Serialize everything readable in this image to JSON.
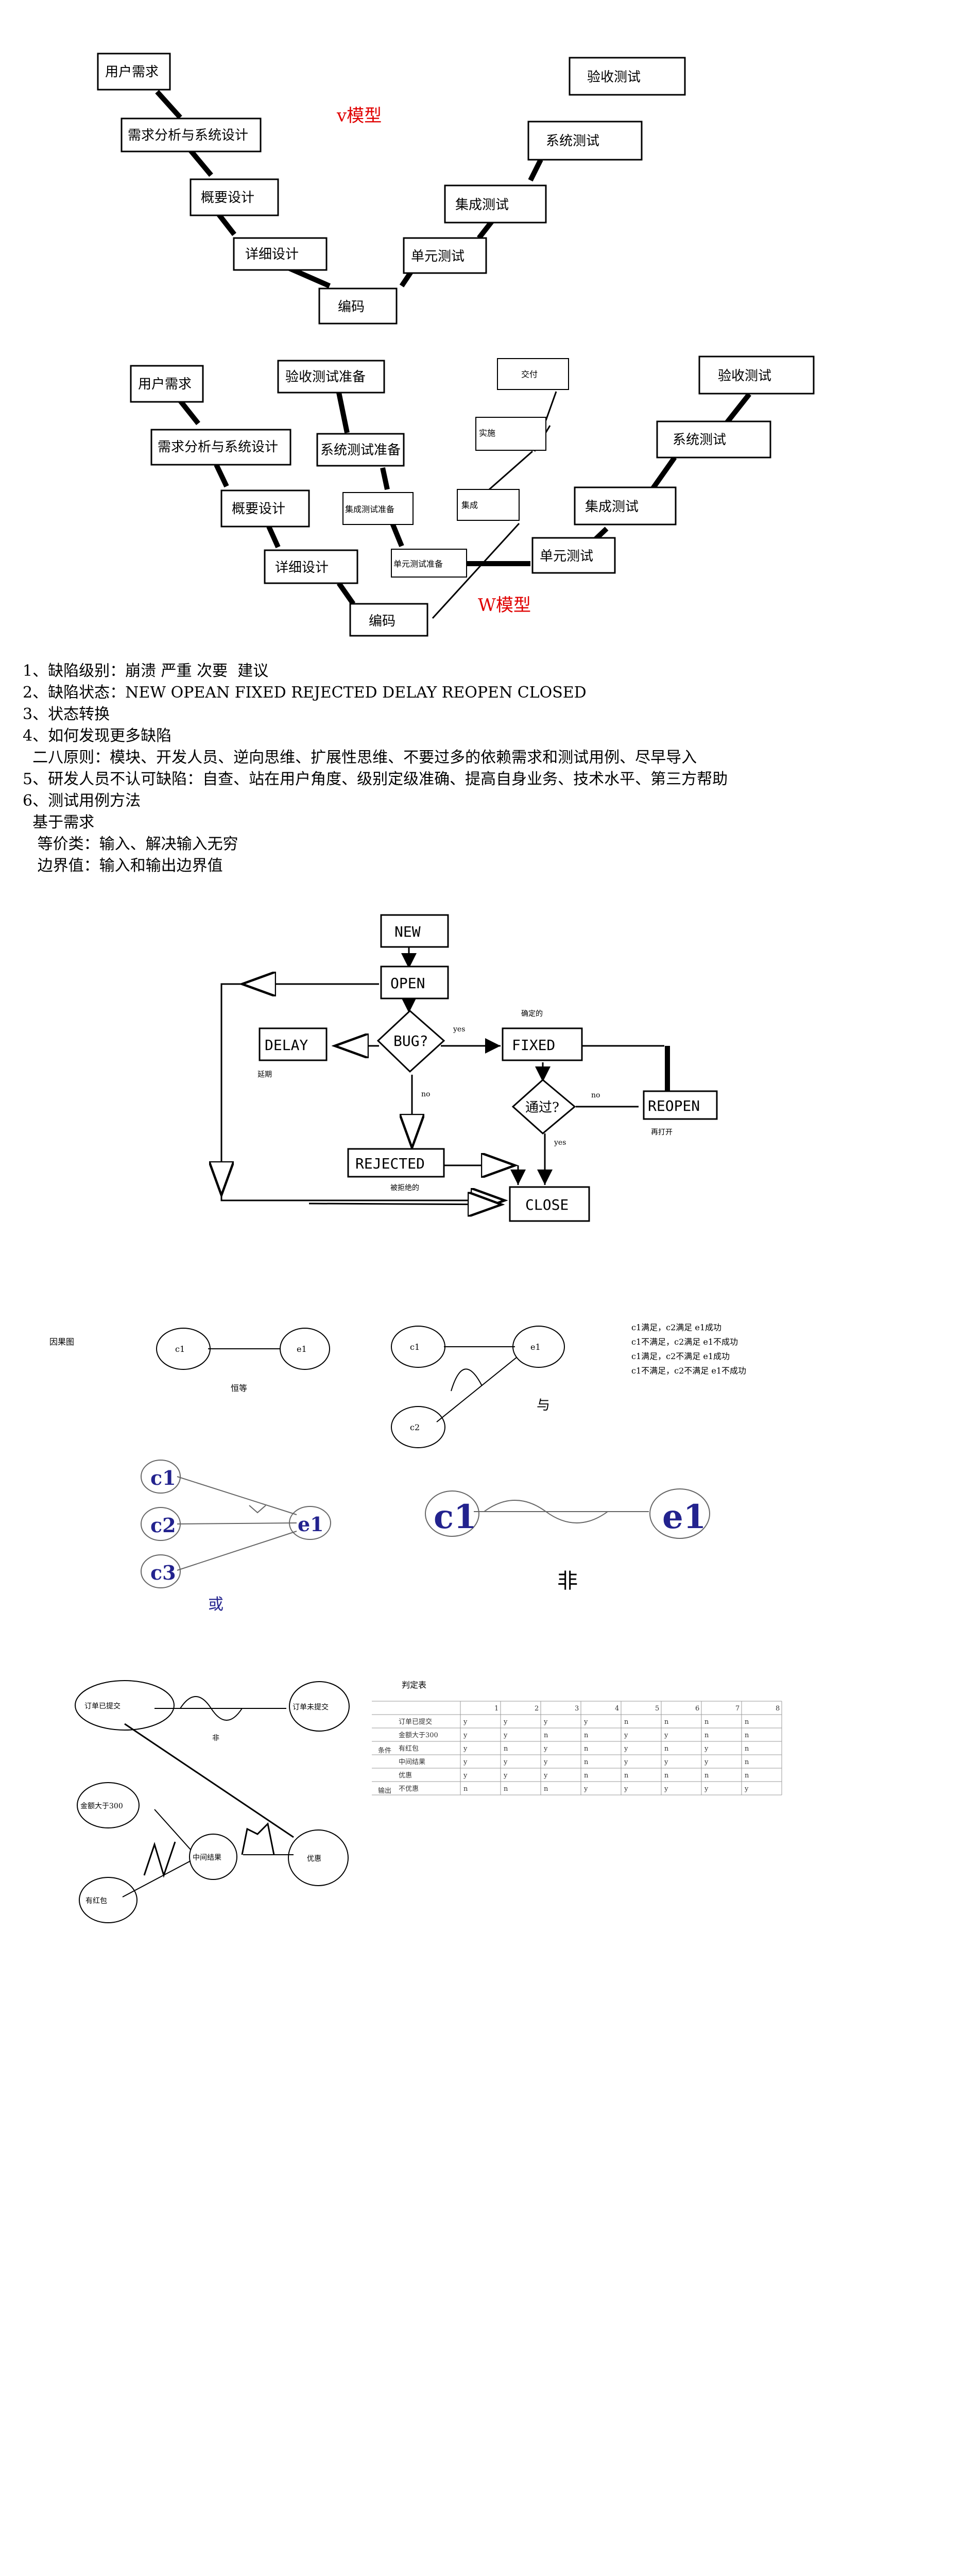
{
  "v_model": {
    "title": "v模型",
    "left": [
      "用户需求",
      "需求分析与系统设计",
      "概要设计",
      "详细设计"
    ],
    "bottom": "编码",
    "right": [
      "单元测试",
      "集成测试",
      "系统测试",
      "验收测试"
    ]
  },
  "w_model": {
    "title": "W模型",
    "left": [
      "用户需求",
      "需求分析与系统设计",
      "概要设计",
      "详细设计"
    ],
    "bottom": "编码",
    "prep": [
      "验收测试准备",
      "系统测试准备",
      "集成测试准备",
      "单元测试准备"
    ],
    "right": [
      "单元测试",
      "集成测试",
      "系统测试",
      "验收测试"
    ],
    "mid": [
      "交付",
      "实施",
      "集成"
    ]
  },
  "notes": [
    "1、缺陷级别：崩溃 严重 次要  建议",
    "2、缺陷状态：NEW OPEAN FIXED REJECTED DELAY REOPEN CLOSED",
    "3、状态转换",
    "4、如何发现更多缺陷",
    "  二八原则：模块、开发人员、逆向思维、扩展性思维、不要过多的依赖需求和测试用例、尽早导入",
    "5、研发人员不认可缺陷：自查、站在用户角度、级别定级准确、提高自身业务、技术水平、第三方帮助",
    "6、测试用例方法",
    "  基于需求",
    "   等价类：输入、解决输入无穷",
    "   边界值：输入和输出边界值"
  ],
  "flow": {
    "new": "NEW",
    "open": "OPEN",
    "bug": "BUG?",
    "delay": "DELAY",
    "delay_note": "延期",
    "yes1": "yes",
    "fixed_note": "确定的",
    "fixed": "FIXED",
    "no1": "no",
    "pass": "通过?",
    "no2": "no",
    "reopen": "REOPEN",
    "reopen_note": "再打开",
    "yes2": "yes",
    "rejected": "REJECTED",
    "rejected_note": "被拒绝的",
    "close": "CLOSE"
  },
  "cause_effect": {
    "label": "因果图",
    "identity": "恒等",
    "and_label": "与",
    "or_label": "或",
    "not_label": "非",
    "c1": "c1",
    "c2": "c2",
    "e1": "e1",
    "big_c1": "c1",
    "big_c2": "c2",
    "big_c3": "c3",
    "big_e1": "e1",
    "rules": [
      "c1满足，c2满足 e1成功",
      "c1不满足，c2满足 e1不成功",
      "c1满足，c2不满足 e1成功",
      "c1不满足，c2不满足 e1不成功"
    ]
  },
  "example": {
    "order_submitted": "订单已提交",
    "order_not_submitted": "订单未提交",
    "not_label": "非",
    "amount_over": "金额大于300",
    "intermediate": "中间结果",
    "red_packet": "有红包",
    "discount": "优惠"
  },
  "decision_table": {
    "title": "判定表",
    "cols": [
      "1",
      "2",
      "3",
      "4",
      "5",
      "6",
      "7",
      "8"
    ],
    "group_cond": "条件",
    "group_out": "输出",
    "rows": [
      {
        "label": "订单已提交",
        "vals": [
          "y",
          "y",
          "y",
          "y",
          "n",
          "n",
          "n",
          "n"
        ]
      },
      {
        "label": "金额大于300",
        "vals": [
          "y",
          "y",
          "n",
          "n",
          "y",
          "y",
          "n",
          "n"
        ]
      },
      {
        "label": "有红包",
        "vals": [
          "y",
          "n",
          "y",
          "n",
          "y",
          "n",
          "y",
          "n"
        ]
      },
      {
        "label": "中间结果",
        "vals": [
          "y",
          "y",
          "y",
          "n",
          "y",
          "y",
          "y",
          "n"
        ]
      },
      {
        "label": "优惠",
        "vals": [
          "y",
          "y",
          "y",
          "n",
          "n",
          "n",
          "n",
          "n"
        ]
      },
      {
        "label": "不优惠",
        "vals": [
          "n",
          "n",
          "n",
          "y",
          "y",
          "y",
          "y",
          "y"
        ]
      }
    ]
  }
}
